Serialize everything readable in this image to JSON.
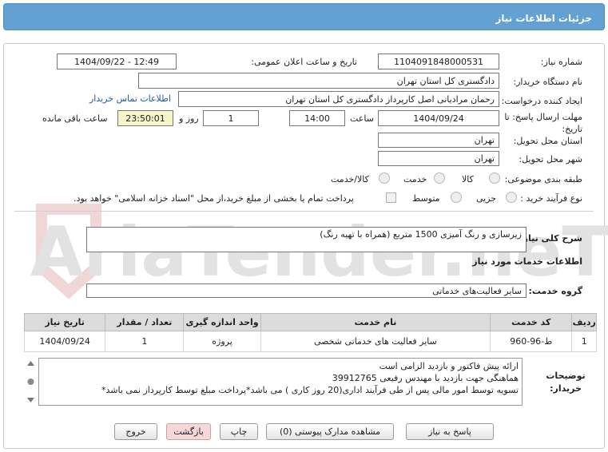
{
  "header": {
    "title": "جزئیات اطلاعات نیاز"
  },
  "fields": {
    "need_number_label": "شماره نیاز:",
    "need_number": "1104091848000531",
    "announce_label": "تاریخ و ساعت اعلان عمومی:",
    "announce_value": "1404/09/22 - 12:49",
    "buyer_org_label": "نام دستگاه خریدار:",
    "buyer_org": "دادگستری کل استان تهران",
    "requester_label": "ایجاد کننده درخواست:",
    "requester": "رحمان مرادیانی اصل کارپرداز دادگستری کل استان تهران",
    "contact_link": "اطلاعات تماس خریدار",
    "deadline_label": "مهلت ارسال پاسخ: تا تاریخ:",
    "deadline_date": "1404/09/24",
    "time_label": "ساعت",
    "deadline_time": "14:00",
    "days_value": "1",
    "days_label": "روز و",
    "remaining_time": "23:50:01",
    "remaining_label": "ساعت باقی مانده",
    "province_label": "استان محل تحویل:",
    "province": "تهران",
    "city_label": "شهر محل تحویل:",
    "city": "تهران",
    "category_label": "طبقه بندی موضوعی:",
    "category_options": [
      "کالا",
      "خدمت",
      "کالا/خدمت"
    ],
    "process_label": "نوع فرآیند خرید :",
    "process_options": [
      "جزیی",
      "متوسط"
    ],
    "payment_note": "پرداخت تمام یا بخشی از مبلغ خرید،از محل \"اسناد خزانه اسلامی\" خواهد بود."
  },
  "description": {
    "label": "شرح کلی نیاز:",
    "value": "زیرسازی و رنگ آمیزی 1500 متربع (همراه با تهیه رنگ)"
  },
  "services_title": "اطلاعات خدمات مورد نیاز",
  "service_group": {
    "label": "گروه خدمت:",
    "value": "سایر فعالیت‌های خدماتی"
  },
  "table": {
    "headers": [
      "ردیف",
      "کد خدمت",
      "نام خدمت",
      "واحد اندازه گیری",
      "تعداد / مقدار",
      "تاریخ نیاز"
    ],
    "rows": [
      [
        "1",
        "ط-96-960",
        "سایر فعالیت های خدماتی شخصی",
        "پروژه",
        "1",
        "1404/09/24"
      ]
    ]
  },
  "notes": {
    "label": "توضیحات خریدار:",
    "lines": [
      "ارائه پیش فاکتور و بازدید الزامی است",
      "هماهنگی جهت بازدید با مهندس رفیعی 39912765",
      "تسویه توسط امور مالی پس از طی فرآیند اداری(20 روز کاری )  می باشد*پرداخت مبلغ توسط کارپرداز نمی باشد*"
    ]
  },
  "buttons": {
    "reply": "پاسخ به نیاز",
    "attachments": "مشاهده مدارک پیوستی (0)",
    "print": "چاپ",
    "back": "بازگشت",
    "exit": "خروج"
  },
  "colors": {
    "header": "#62a1d2",
    "link": "#1e5aa8",
    "highlight": "#f7f3c9",
    "watermark": "#e2e2e2",
    "watermark_accent": "#f0d6d6"
  },
  "watermark": {
    "text": "AriaTender.neT"
  }
}
